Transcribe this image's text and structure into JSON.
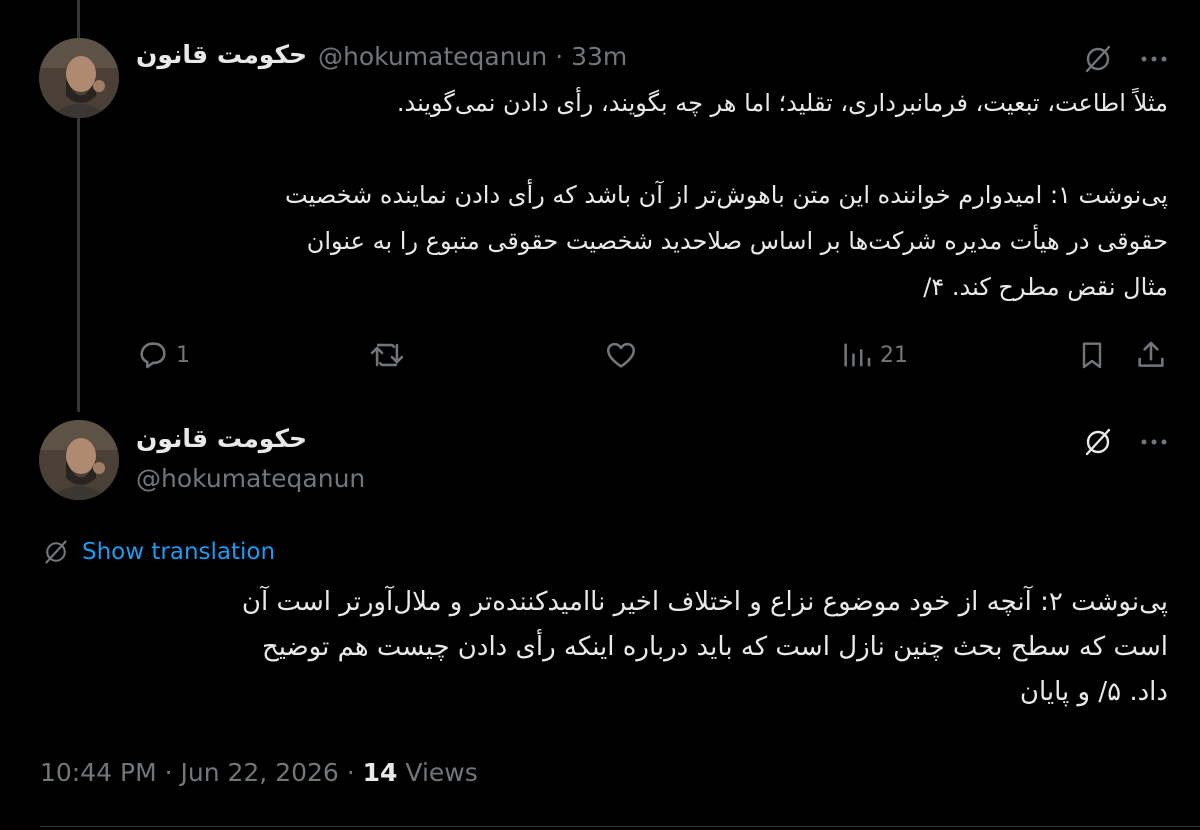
{
  "tweet1": {
    "display_name": "حکومت قانون",
    "handle_time": "@hokumateqanun · 33m",
    "body_lines": [
      "مثلاً اطاعت، تبعیت، فرمانبرداری، تقلید؛ اما هر چه بگویند، رأی دادن نمی‌گویند.",
      "",
      "پی‌نوشت ۱: امیدوارم خواننده این متن باهوش‌تر از آن باشد که رأی دادن نماینده شخصیت",
      "حقوقی در هیأت مدیره شرکت‌ها بر اساس صلاحدید شخصیت حقوقی متبوع را به عنوان",
      "مثال نقض مطرح کند. ۴/"
    ],
    "reply_count": "1",
    "views_count": "21",
    "icons": [
      "no-translate-icon",
      "more-icon",
      "reply-icon",
      "retweet-icon",
      "like-icon",
      "views-icon",
      "bookmark-icon",
      "share-icon"
    ]
  },
  "tweet2": {
    "display_name": "حکومت قانون",
    "handle": "@hokumateqanun",
    "show_translation": "Show translation",
    "body_lines": [
      "پی‌نوشت ۲: آنچه از خود موضوع نزاع و اختلاف اخیر ناامیدکننده‌تر و ملال‌آورتر است آن",
      "است که سطح بحث چنین نازل است که باید درباره اینکه رأی دادن چیست هم توضیح",
      "داد. ۵/ و پایان"
    ],
    "timestamp": "10:44 PM · Jun 22, 2026 · ",
    "views_count": "14",
    "views_label": " Views"
  },
  "colors": {
    "background": "#000000",
    "text": "#e7e9ea",
    "muted": "#71767b",
    "link": "#1d9bf0"
  }
}
